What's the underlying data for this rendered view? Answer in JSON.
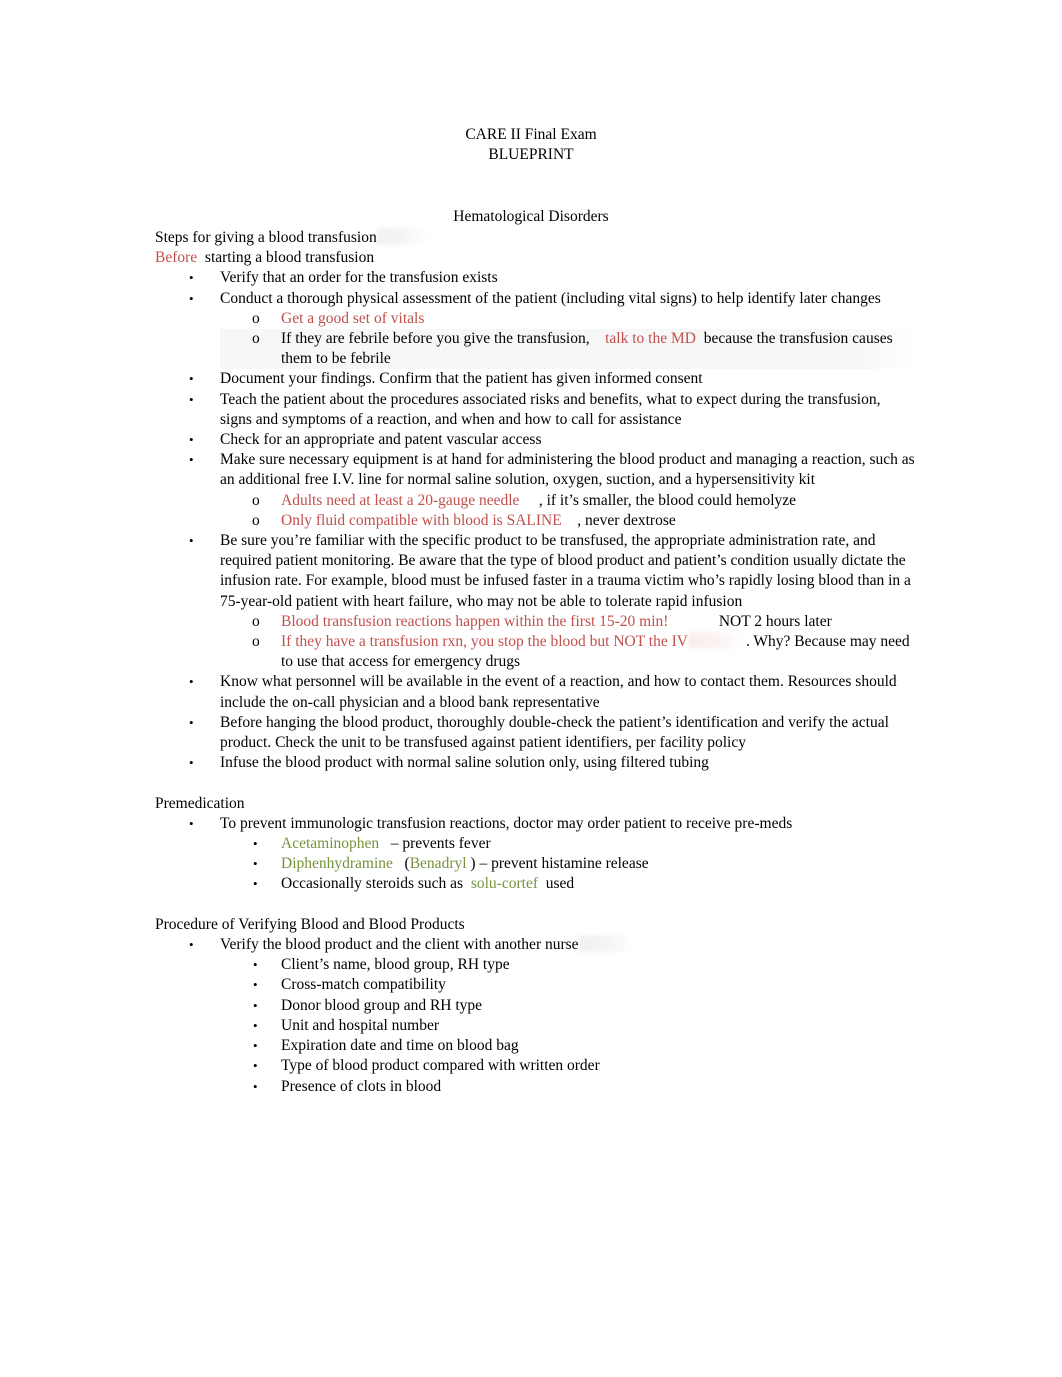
{
  "document": {
    "title_line1": "CARE II Final Exam",
    "title_line2": "BLUEPRINT",
    "main_section": "Hematological Disorders"
  },
  "transfusion": {
    "heading": "Steps for giving a blood transfusion",
    "subheading_red": "Before",
    "subheading_rest": "  starting a blood transfusion",
    "items": [
      {
        "text": "Verify that an order for the transfusion exists"
      },
      {
        "text": "Conduct a thorough physical assessment of the patient (including vital signs) to help identify later changes",
        "sub": [
          {
            "red": "Get a good set of vitals",
            "black": ""
          },
          {
            "red_inline_before": "If they are febrile before you give the transfusion,",
            "red": "talk to the MD",
            "black": "because the transfusion causes them to be febrile"
          }
        ]
      },
      {
        "text": "Document your findings. Confirm that the patient has given informed consent"
      },
      {
        "text": "Teach the patient about the procedures associated risks and benefits, what to expect during the transfusion, signs and symptoms of a reaction, and when and how to call for assistance"
      },
      {
        "text": "Check for an appropriate and patent vascular access"
      },
      {
        "text": "Make sure necessary equipment is at hand for administering the blood product and managing a reaction, such as an additional free I.V. line for normal saline solution, oxygen, suction, and a hypersensitivity kit",
        "sub": [
          {
            "red": "Adults need at least a 20-gauge needle",
            "black": ", if it’s smaller, the blood could hemolyze"
          },
          {
            "red": "Only fluid compatible with blood is SALINE",
            "black": ", never dextrose"
          }
        ]
      },
      {
        "text": "Be sure you’re familiar with the specific product to be transfused, the appropriate administration rate, and required patient monitoring. Be aware that the type of blood product and patient’s condition usually dictate the infusion rate. For example, blood must be infused faster in a trauma victim who’s rapidly losing blood than in a 75-year-old patient with heart failure, who may not be able to tolerate rapid infusion",
        "sub": [
          {
            "red": "Blood transfusion reactions happen within the first 15-20 min!",
            "black": "NOT 2 hours later"
          },
          {
            "red": "If they have a transfusion rxn, you stop the blood but NOT the IV",
            "black": ". Why? Because may need to use that access for emergency drugs"
          }
        ]
      },
      {
        "text": "Know what personnel will be available in the event of a reaction, and how to contact them. Resources should include the on-call physician and a blood bank representative"
      },
      {
        "text": "Before hanging the blood product, thoroughly double-check the patient’s identification and verify the actual product. Check the unit to be transfused against patient identifiers, per facility policy"
      },
      {
        "text": "Infuse the blood product with normal saline solution only, using filtered tubing"
      }
    ]
  },
  "premedication": {
    "heading": "Premedication",
    "lead": "To prevent immunologic transfusion reactions, doctor may order patient to receive pre-meds",
    "drugs": [
      {
        "name": "Acetaminophen",
        "desc": "– prevents fever"
      },
      {
        "name": "Diphenhydramine",
        "paren_open": "(",
        "brand": "Benadryl",
        "paren_close": ")",
        "desc": "– prevent histamine release"
      },
      {
        "prefix": "Occasionally steroids such as",
        "name": "solu-cortef",
        "desc": "used"
      }
    ]
  },
  "verifying": {
    "heading": "Procedure of Verifying Blood and Blood Products",
    "lead": "Verify the blood product and the client with another nurse",
    "checks": [
      "Client’s name, blood group, RH type",
      "Cross-match compatibility",
      "Donor blood group and RH type",
      "Unit and hospital number",
      "Expiration date and time on blood bag",
      "Type of blood product compared with written order",
      "Presence of clots in blood"
    ]
  },
  "icons": {
    "bullet_disc": "•",
    "bullet_circle": "o"
  },
  "colors": {
    "accent_red": "#c0504d",
    "accent_green": "#77933c",
    "text": "#000000",
    "background": "#ffffff"
  }
}
